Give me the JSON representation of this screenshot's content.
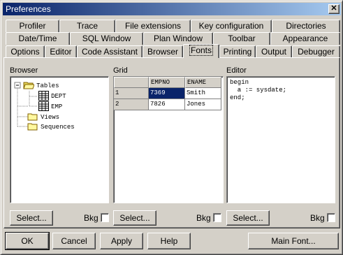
{
  "window": {
    "title": "Preferences"
  },
  "tabs_row1": [
    "Profiler",
    "Trace",
    "File extensions",
    "Key configuration",
    "Directories"
  ],
  "tabs_row2": [
    "Date/Time",
    "SQL Window",
    "Plan Window",
    "Toolbar",
    "Appearance"
  ],
  "tabs_row3": [
    "Options",
    "Editor",
    "Code Assistant",
    "Browser",
    "Fonts",
    "Printing",
    "Output",
    "Debugger"
  ],
  "active_tab": "Fonts",
  "browser": {
    "label": "Browser",
    "tree": {
      "tables": "Tables",
      "dept": "DEPT",
      "emp": "EMP",
      "views": "Views",
      "sequences": "Sequences"
    }
  },
  "grid": {
    "label": "Grid",
    "columns": [
      "EMPNO",
      "ENAME"
    ],
    "rows": [
      {
        "num": "1",
        "empno": "7369",
        "ename": "Smith"
      },
      {
        "num": "2",
        "empno": "7826",
        "ename": "Jones"
      }
    ]
  },
  "editor": {
    "label": "Editor",
    "lines": [
      "begin",
      "  a := sysdate;",
      "end;"
    ]
  },
  "select_label": "Select...",
  "bkg_label": "Bkg",
  "footer": {
    "ok": "OK",
    "cancel": "Cancel",
    "apply": "Apply",
    "help": "Help",
    "main_font": "Main Font..."
  },
  "colors": {
    "selection": "#0a246a",
    "titlebar": "#0a246a"
  }
}
